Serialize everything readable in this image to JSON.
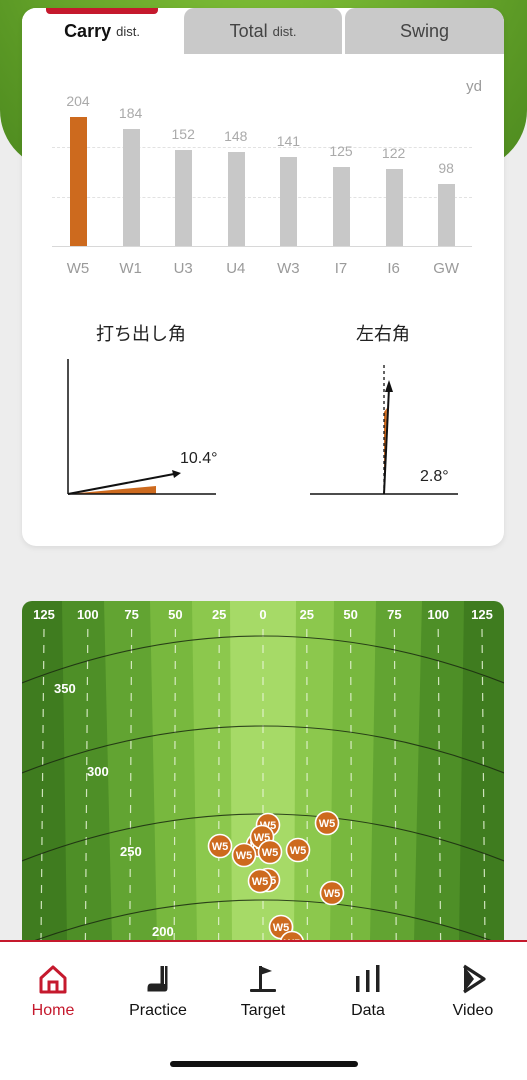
{
  "tabs": [
    {
      "main": "Carry",
      "small": "dist."
    },
    {
      "main": "Total",
      "small": "dist."
    },
    {
      "main": "Swing",
      "small": ""
    }
  ],
  "unit": "yd",
  "chart_data": {
    "type": "bar",
    "categories": [
      "W5",
      "W1",
      "U3",
      "U4",
      "W3",
      "I7",
      "I6",
      "GW"
    ],
    "values": [
      204,
      184,
      152,
      148,
      141,
      125,
      122,
      98
    ],
    "highlight": "W5",
    "highlight_color": "#cd6a1e",
    "bar_color": "#c8c8c8",
    "ylim": [
      0,
      220
    ]
  },
  "launch": {
    "title": "打ち出し角",
    "value": "10.4°"
  },
  "direction": {
    "title": "左右角",
    "value": "2.8°"
  },
  "range": {
    "top_labels": [
      "125",
      "100",
      "75",
      "50",
      "25",
      "0",
      "25",
      "50",
      "75",
      "100",
      "125"
    ],
    "arc_labels": [
      "350",
      "300",
      "250",
      "200"
    ],
    "marker_label": "W5"
  },
  "nav": [
    {
      "label": "Home",
      "icon": "home-icon"
    },
    {
      "label": "Practice",
      "icon": "golf-club-icon"
    },
    {
      "label": "Target",
      "icon": "target-flag-icon"
    },
    {
      "label": "Data",
      "icon": "bar-chart-icon"
    },
    {
      "label": "Video",
      "icon": "play-icon"
    }
  ],
  "colors": {
    "accent": "#c5192d",
    "orange": "#cd6a1e"
  }
}
